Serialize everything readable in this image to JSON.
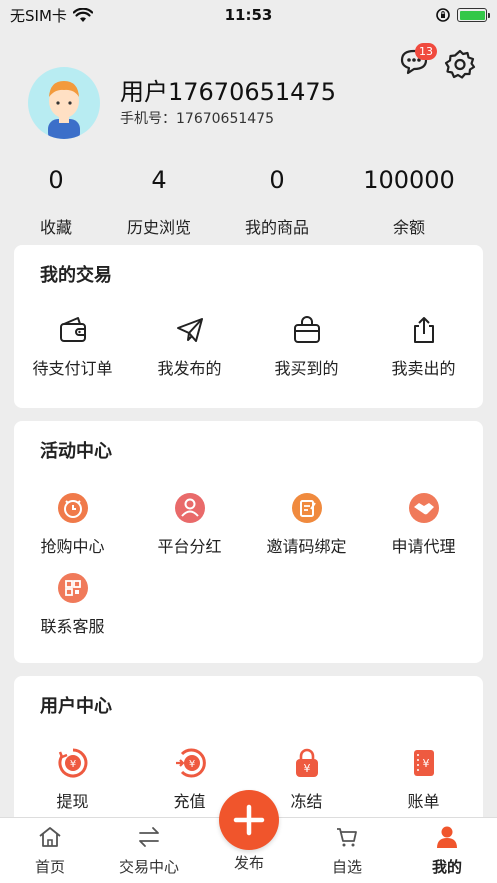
{
  "status_bar": {
    "carrier": "无SIM卡",
    "time": "11:53"
  },
  "profile": {
    "username": "用户17670651475",
    "phone_label": "手机号：",
    "phone": "17670651475",
    "message_count": "13"
  },
  "stats": [
    {
      "value": "0",
      "label": "收藏"
    },
    {
      "value": "4",
      "label": "历史浏览"
    },
    {
      "value": "0",
      "label": "我的商品"
    },
    {
      "value": "100000",
      "label": "余额"
    }
  ],
  "my_trades": {
    "title": "我的交易",
    "items": [
      {
        "label": "待支付订单",
        "icon": "wallet-icon"
      },
      {
        "label": "我发布的",
        "icon": "paper-plane-icon"
      },
      {
        "label": "我买到的",
        "icon": "shopping-bag-icon"
      },
      {
        "label": "我卖出的",
        "icon": "share-icon"
      }
    ]
  },
  "activity_center": {
    "title": "活动中心",
    "items": [
      {
        "label": "抢购中心",
        "icon": "alarm-clock-icon"
      },
      {
        "label": "平台分红",
        "icon": "user-icon"
      },
      {
        "label": "邀请码绑定",
        "icon": "edit-note-icon"
      },
      {
        "label": "申请代理",
        "icon": "handshake-icon"
      },
      {
        "label": "联系客服",
        "icon": "qr-code-icon"
      }
    ]
  },
  "user_center": {
    "title": "用户中心",
    "items": [
      {
        "label": "提现",
        "icon": "withdraw-yen-icon"
      },
      {
        "label": "充值",
        "icon": "recharge-yen-icon"
      },
      {
        "label": "冻结",
        "icon": "lock-yen-icon"
      },
      {
        "label": "账单",
        "icon": "bill-yen-icon"
      }
    ]
  },
  "tabbar": {
    "items": [
      {
        "label": "首页",
        "icon": "home-icon"
      },
      {
        "label": "交易中心",
        "icon": "exchange-icon"
      },
      {
        "label": "发布",
        "icon": "plus-icon"
      },
      {
        "label": "自选",
        "icon": "cart-icon"
      },
      {
        "label": "我的",
        "icon": "person-icon"
      }
    ],
    "active": "我的"
  },
  "colors": {
    "accent": "#f0552c",
    "badge": "#f04a3e",
    "background": "#ededed",
    "avatar_bg": "#b8ecf2"
  }
}
